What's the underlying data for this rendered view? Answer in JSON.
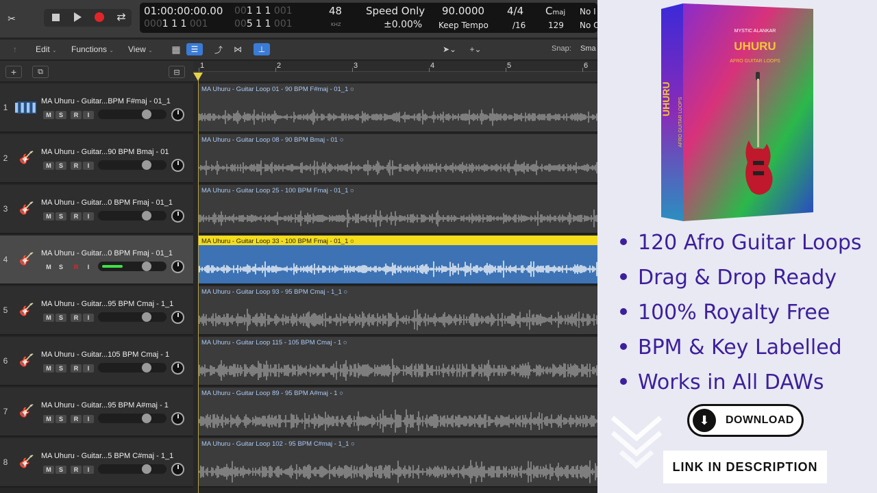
{
  "transport": {
    "time_code": "01:00:00:00.00",
    "bars_dim": "00",
    "bars": "1  1  1",
    "sub_dim": "001",
    "row2_dim_a": "000",
    "row2": "1  1  1",
    "row2_dim_b": "001",
    "row2_dim_c": "00",
    "row2_b": "5  1  1",
    "row2_dim_d": "001",
    "sample_rate": "48",
    "sample_unit": "KHZ",
    "speed_mode": "Speed Only",
    "speed_pct": "±0.00%",
    "tempo": "90.0000",
    "tempo_mode": "Keep Tempo",
    "sig": "4/4",
    "division": "/16",
    "key_root": "C",
    "key_mode": "maj",
    "key_value": "129",
    "no_in": "No I",
    "no_out": "No O"
  },
  "toolbar": {
    "edit": "Edit",
    "functions": "Functions",
    "view": "View",
    "snap_label": "Snap:",
    "snap_value": "Sma"
  },
  "ruler": [
    "1",
    "2",
    "3",
    "4",
    "5",
    "6"
  ],
  "tracks": [
    {
      "num": "1",
      "name": "MA Uhuru - Guitar...BPM F#maj - 01_1",
      "region": "MA Uhuru - Guitar Loop 01 - 90 BPM F#maj - 01_1",
      "icon": "waveform-icon"
    },
    {
      "num": "2",
      "name": "MA Uhuru - Guitar...90 BPM Bmaj - 01",
      "region": "MA Uhuru - Guitar Loop 08 - 90 BPM Bmaj - 01",
      "icon": "guitar-icon"
    },
    {
      "num": "3",
      "name": "MA Uhuru - Guitar...0 BPM Fmaj - 01_1",
      "region": "MA Uhuru - Guitar Loop 25 - 100 BPM Fmaj - 01_1",
      "icon": "guitar-icon"
    },
    {
      "num": "4",
      "name": "MA Uhuru - Guitar...0 BPM Fmaj - 01_1",
      "region": "MA Uhuru - Guitar Loop 33 - 100 BPM Fmaj - 01_1",
      "icon": "guitar-icon",
      "selected": true
    },
    {
      "num": "5",
      "name": "MA Uhuru - Guitar...95 BPM Cmaj - 1_1",
      "region": "MA Uhuru - Guitar Loop 93 - 95 BPM Cmaj - 1_1",
      "icon": "guitar-icon"
    },
    {
      "num": "6",
      "name": "MA Uhuru - Guitar...105 BPM Cmaj - 1",
      "region": "MA Uhuru - Guitar Loop 115 - 105 BPM Cmaj - 1",
      "icon": "guitar-icon"
    },
    {
      "num": "7",
      "name": "MA Uhuru - Guitar...95 BPM A#maj - 1",
      "region": "MA Uhuru - Guitar Loop 89 - 95 BPM A#maj - 1",
      "icon": "guitar-icon"
    },
    {
      "num": "8",
      "name": "MA Uhuru - Guitar...5 BPM C#maj - 1_1",
      "region": "MA Uhuru - Guitar Loop 102 - 95 BPM C#maj - 1_1",
      "icon": "guitar-icon"
    }
  ],
  "track_buttons": [
    "M",
    "S",
    "R",
    "I"
  ],
  "product": {
    "brand": "MYSTIC ALANKAR",
    "title": "UHURU",
    "subtitle": "AFRO GUITAR LOOPS"
  },
  "features": [
    "120 Afro Guitar Loops",
    "Drag & Drop Ready",
    "100% Royalty Free",
    "BPM & Key Labelled",
    "Works in All DAWs"
  ],
  "download_label": "DOWNLOAD",
  "link_label": "LINK IN DESCRIPTION",
  "colors": {
    "selected_region": "#3d73b5",
    "selected_label": "#f4dd1d",
    "feature_text": "#3d1f9c"
  }
}
